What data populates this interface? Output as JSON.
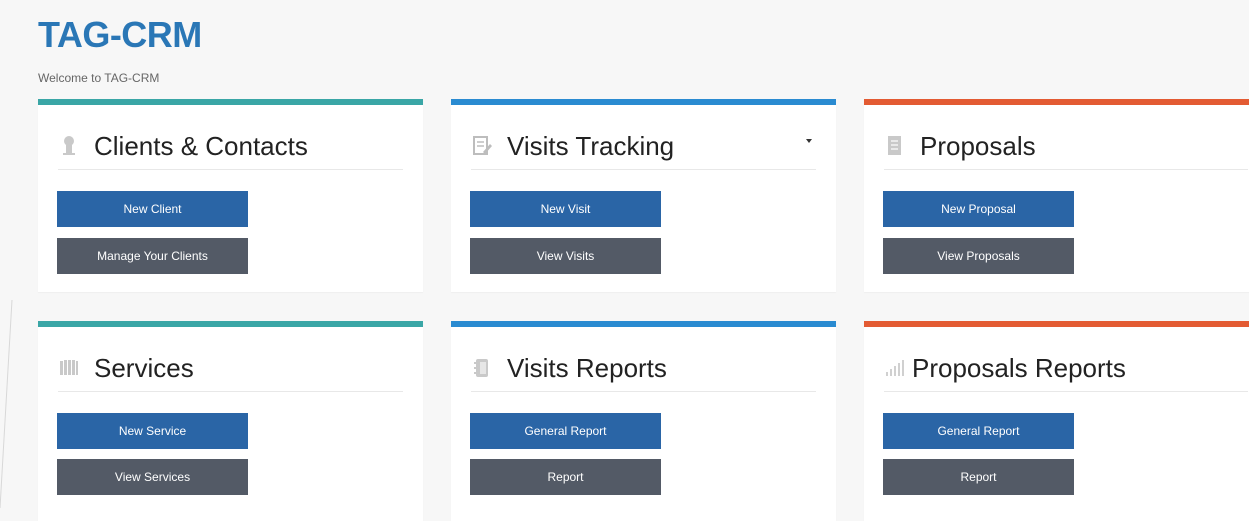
{
  "app": {
    "title": "TAG-CRM",
    "welcome": "Welcome to TAG-CRM"
  },
  "colors": {
    "teal": "#3aa6a6",
    "blue": "#2a8bd1",
    "orange": "#e35b33",
    "primary_button": "#2a65a6",
    "secondary_button": "#535a66",
    "title": "#2a77b6"
  },
  "cards": [
    {
      "title": "Clients & Contacts",
      "icon": "user-icon",
      "accent": "teal",
      "primary": "New Client",
      "secondary": "Manage Your Clients"
    },
    {
      "title": "Visits Tracking",
      "icon": "edit-document-icon",
      "accent": "blue",
      "has_dropdown": true,
      "primary": "New Visit",
      "secondary": "View Visits"
    },
    {
      "title": "Proposals",
      "icon": "document-icon",
      "accent": "orange",
      "primary": "New Proposal",
      "secondary": "View Proposals"
    },
    {
      "title": "Services",
      "icon": "services-icon",
      "accent": "teal",
      "primary": "New Service",
      "secondary": "View Services"
    },
    {
      "title": "Visits Reports",
      "icon": "report-book-icon",
      "accent": "blue",
      "primary": "General Report",
      "secondary": "Report"
    },
    {
      "title": "Proposals Reports",
      "icon": "signal-bars-icon",
      "accent": "orange",
      "primary": "General Report",
      "secondary": "Report"
    }
  ]
}
